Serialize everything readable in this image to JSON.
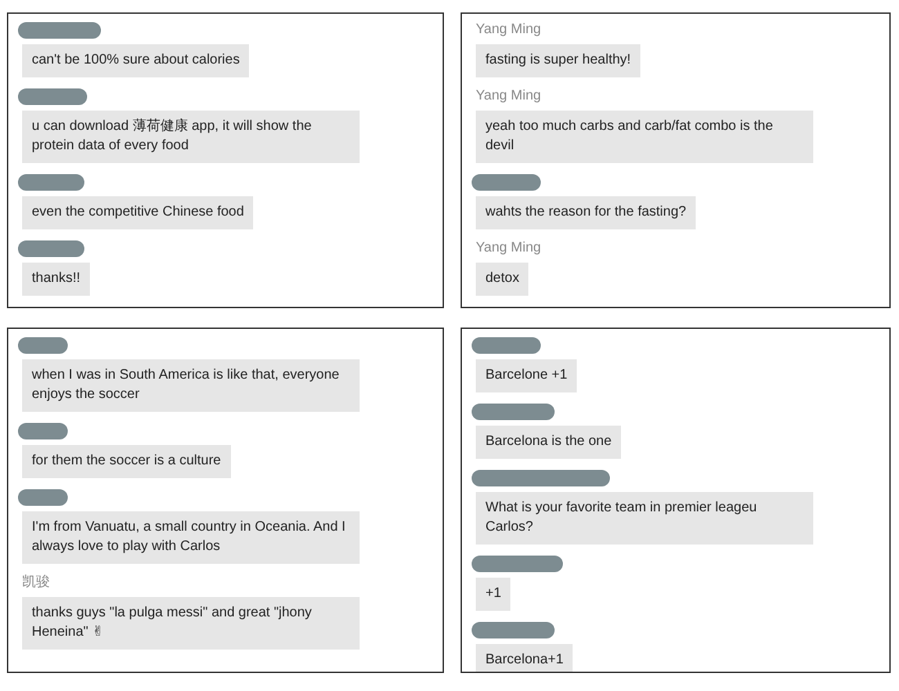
{
  "panels": [
    {
      "messages": [
        {
          "sender": {
            "kind": "hidden"
          },
          "text": "can't be 100% sure about calories"
        },
        {
          "sender": {
            "kind": "hidden"
          },
          "text": "u can download 薄荷健康 app, it will show the protein data of every food"
        },
        {
          "sender": {
            "kind": "hidden"
          },
          "text": "even the competitive Chinese food"
        },
        {
          "sender": {
            "kind": "hidden"
          },
          "text": "thanks!!"
        }
      ]
    },
    {
      "messages": [
        {
          "sender": {
            "kind": "name",
            "name": "Yang Ming"
          },
          "text": "fasting is super healthy!"
        },
        {
          "sender": {
            "kind": "name",
            "name": "Yang Ming"
          },
          "text": "yeah too much carbs and carb/fat combo is the devil"
        },
        {
          "sender": {
            "kind": "hidden"
          },
          "text": "wahts the reason for the fasting?"
        },
        {
          "sender": {
            "kind": "name",
            "name": "Yang Ming"
          },
          "text": "detox"
        }
      ]
    },
    {
      "messages": [
        {
          "sender": {
            "kind": "hidden"
          },
          "text": "when I was in South America is like that, everyone enjoys the soccer"
        },
        {
          "sender": {
            "kind": "hidden"
          },
          "text": "for them the soccer is a culture"
        },
        {
          "sender": {
            "kind": "hidden"
          },
          "text": "I'm from Vanuatu, a small country in Oceania. And I always love to play with Carlos"
        },
        {
          "sender": {
            "kind": "name",
            "name": "凯骏"
          },
          "text": "thanks guys \"la pulga messi\" and great \"jhony Heneina\" ✌"
        }
      ]
    },
    {
      "messages": [
        {
          "sender": {
            "kind": "hidden"
          },
          "text": "Barcelone +1"
        },
        {
          "sender": {
            "kind": "hidden"
          },
          "text": "Barcelona is the one"
        },
        {
          "sender": {
            "kind": "hidden"
          },
          "text": "What is your favorite team in premier leageu Carlos?"
        },
        {
          "sender": {
            "kind": "hidden"
          },
          "text": "+1"
        },
        {
          "sender": {
            "kind": "hidden"
          },
          "text": "Barcelona+1"
        }
      ]
    }
  ]
}
